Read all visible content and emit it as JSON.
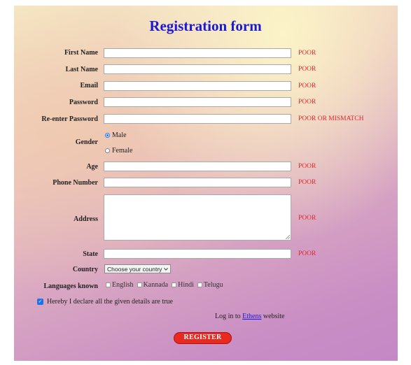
{
  "form": {
    "title": "Registration form",
    "fields": [
      {
        "label": "First Name",
        "status": "POOR"
      },
      {
        "label": "Last Name",
        "status": "POOR"
      },
      {
        "label": "Email",
        "status": "POOR"
      },
      {
        "label": "Password",
        "status": "POOR"
      },
      {
        "label": "Re-enter Password",
        "status": "POOR OR MISMATCH"
      },
      {
        "label": "Age",
        "status": "POOR"
      },
      {
        "label": "Phone Number",
        "status": "POOR"
      },
      {
        "label": "Address",
        "status": "POOR"
      },
      {
        "label": "State",
        "status": "POOR"
      }
    ],
    "gender": {
      "label": "Gender",
      "options": [
        "Male",
        "Female"
      ],
      "selected": "Male"
    },
    "country": {
      "label": "Country",
      "selected": "Choose your country"
    },
    "languages": {
      "label": "Languages known",
      "options": [
        "English",
        "Kannada",
        "Hindi",
        "Telugu"
      ]
    },
    "declaration": {
      "text": "Hereby I declare all the given details are true",
      "checked": true
    },
    "login": {
      "prefix": "Log in to",
      "link": "Ethens",
      "suffix": "website"
    },
    "register_label": "REGISTER",
    "colors": {
      "title": "#1a1ad6",
      "status": "#e0262a",
      "button": "#e8291f"
    }
  }
}
